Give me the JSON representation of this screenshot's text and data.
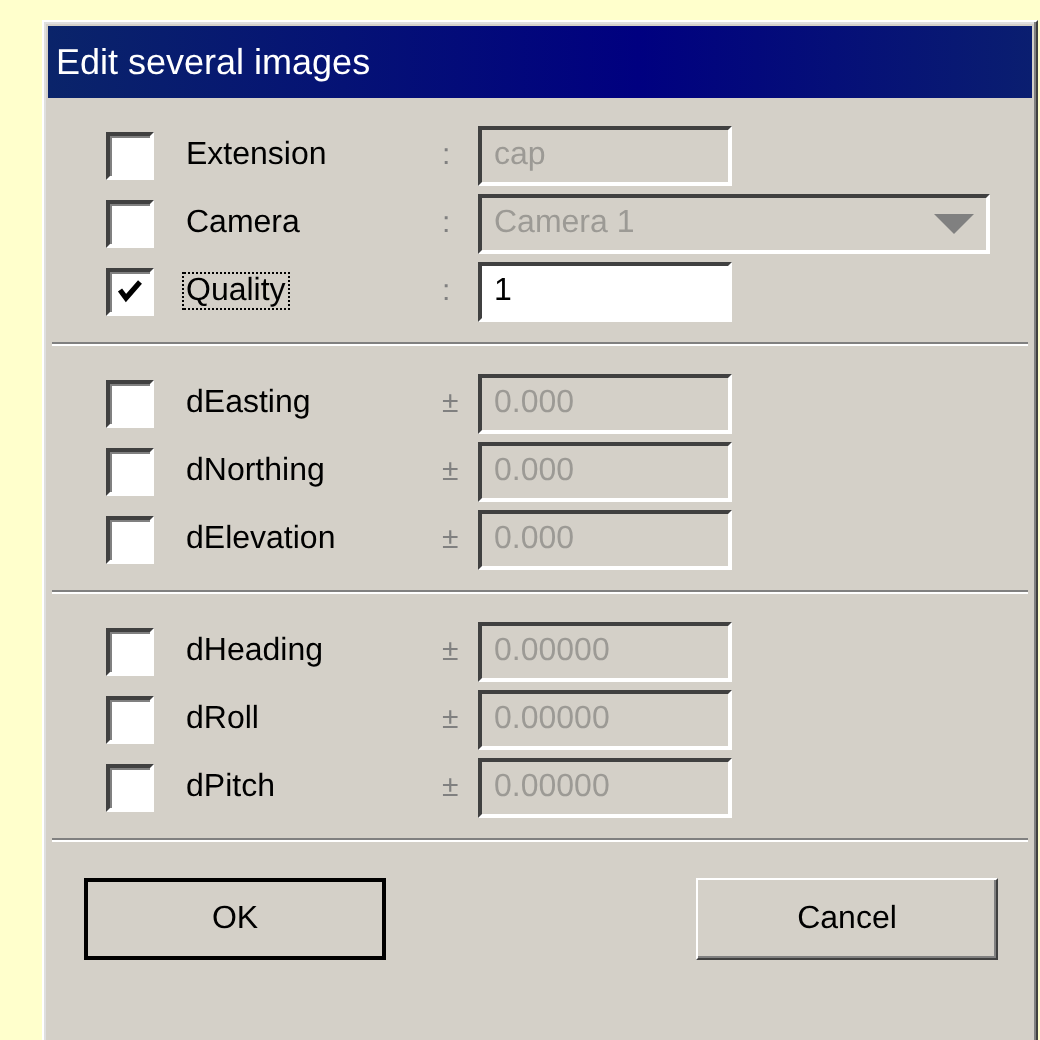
{
  "window": {
    "title": "Edit several images"
  },
  "sections": [
    {
      "rows": [
        {
          "label": "Extension",
          "checked": false,
          "focused": false,
          "separator": ":",
          "kind": "text",
          "value": "cap",
          "disabled": true
        },
        {
          "label": "Camera",
          "checked": false,
          "focused": false,
          "separator": ":",
          "kind": "combo",
          "value": "Camera 1",
          "disabled": true
        },
        {
          "label": "Quality",
          "checked": true,
          "focused": true,
          "separator": ":",
          "kind": "text",
          "value": "1",
          "disabled": false
        }
      ]
    },
    {
      "rows": [
        {
          "label": "dEasting",
          "checked": false,
          "focused": false,
          "separator": "±",
          "kind": "text",
          "value": "0.000",
          "disabled": true
        },
        {
          "label": "dNorthing",
          "checked": false,
          "focused": false,
          "separator": "±",
          "kind": "text",
          "value": "0.000",
          "disabled": true
        },
        {
          "label": "dElevation",
          "checked": false,
          "focused": false,
          "separator": "±",
          "kind": "text",
          "value": "0.000",
          "disabled": true
        }
      ]
    },
    {
      "rows": [
        {
          "label": "dHeading",
          "checked": false,
          "focused": false,
          "separator": "±",
          "kind": "text",
          "value": "0.00000",
          "disabled": true
        },
        {
          "label": "dRoll",
          "checked": false,
          "focused": false,
          "separator": "±",
          "kind": "text",
          "value": "0.00000",
          "disabled": true
        },
        {
          "label": "dPitch",
          "checked": false,
          "focused": false,
          "separator": "±",
          "kind": "text",
          "value": "0.00000",
          "disabled": true
        }
      ]
    }
  ],
  "buttons": [
    {
      "label": "OK",
      "default": true
    },
    {
      "label": "Cancel",
      "default": false
    }
  ]
}
